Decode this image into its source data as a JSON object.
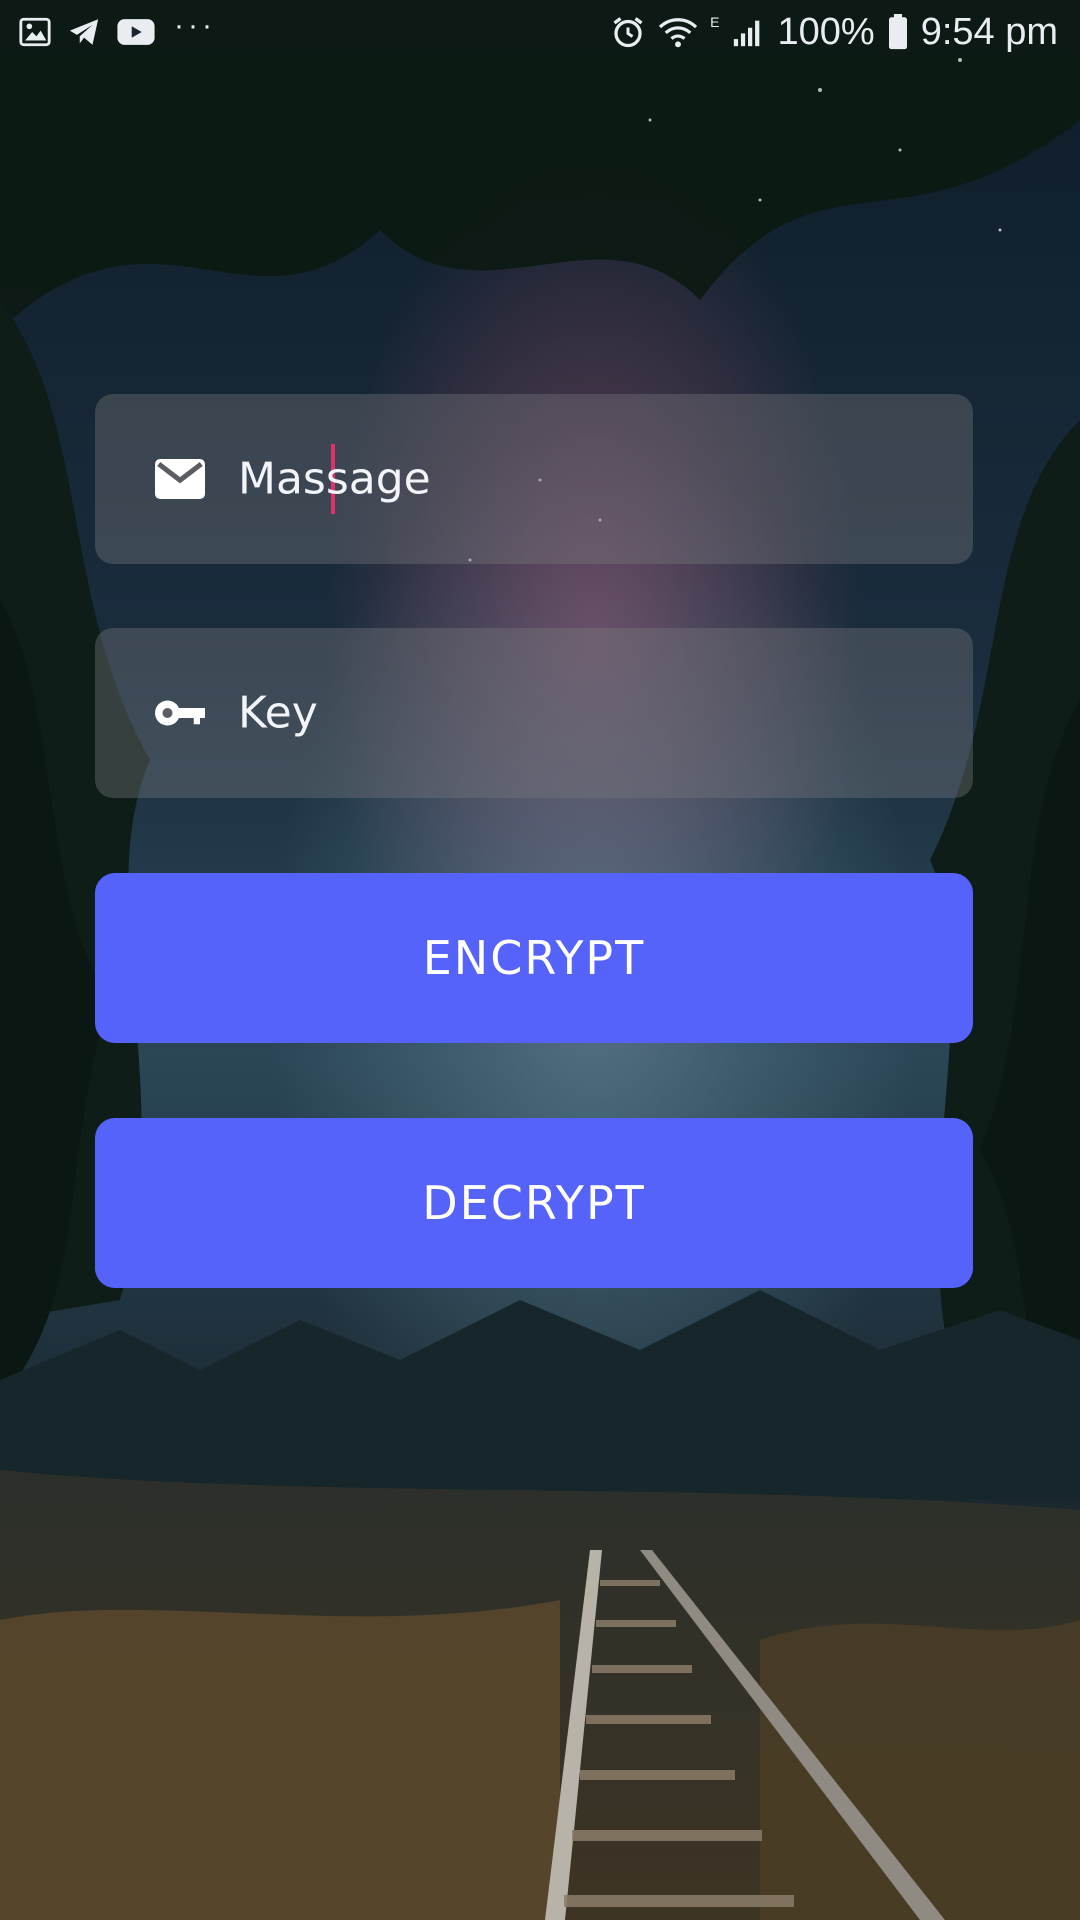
{
  "status_bar": {
    "signal_letter": "E",
    "battery": "100%",
    "time": "9:54 pm",
    "left_icons": [
      "gallery-icon",
      "telegram-icon",
      "youtube-icon",
      "more-dots-icon"
    ],
    "right_icons": [
      "alarm-icon",
      "wifi-icon",
      "cell-signal-icon",
      "battery-icon"
    ],
    "more_label": "···"
  },
  "form": {
    "message": {
      "placeholder": "Massage",
      "value": "",
      "icon": "mail-icon"
    },
    "key": {
      "placeholder": "Key",
      "value": "",
      "icon": "key-icon"
    },
    "encrypt_label": "ENCRYPT",
    "decrypt_label": "DECRYPT"
  },
  "colors": {
    "button": "#5663fb",
    "field_bg": "rgba(120,120,125,0.38)",
    "caret": "#e0316b",
    "text": "#f2f4f8"
  }
}
